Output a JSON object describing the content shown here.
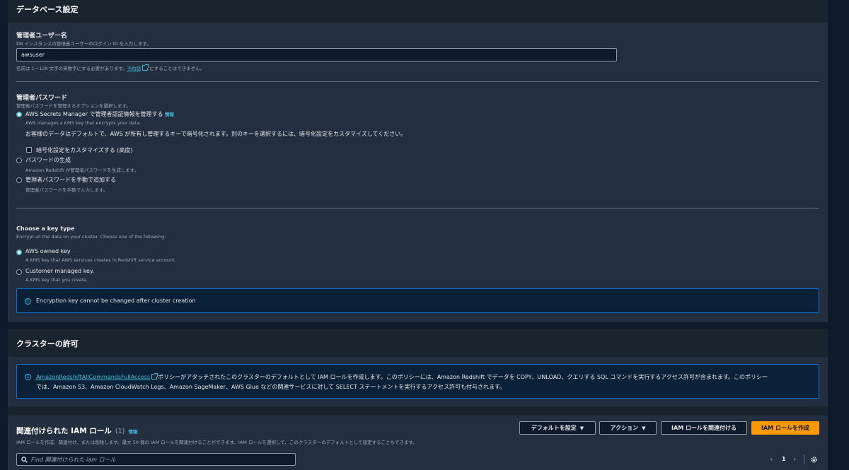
{
  "db_settings": {
    "title": "データベース設定",
    "admin_user": {
      "label": "管理者ユーザー名",
      "desc": "DB インスタンスの管理者ユーザーのログイン ID を入力します。",
      "value": "awsuser",
      "hint_before": "名前は 1〜128 文字の英数字にする必要があります。",
      "hint_link": "予約語",
      "hint_after": "にすることはできません。"
    },
    "admin_password": {
      "label": "管理者パスワード",
      "desc": "管理者パスワードを管理するオプションを選択します。",
      "options": [
        {
          "label": "AWS Secrets Manager で管理者認証情報を管理する",
          "info": "情報",
          "desc": "AWS manages a KMS key that encrypts your data.",
          "selected": true
        },
        {
          "label": "パスワードの生成",
          "desc": "Amazon Redshift が管理者パスワードを生成します。",
          "selected": false
        },
        {
          "label": "管理者パスワードを手動で追加する",
          "desc": "管理者パスワードを手動で入力します。",
          "selected": false
        }
      ],
      "encrypt_note": "お客様のデータはデフォルトで、AWS が所有し管理するキーで暗号化されます。別のキーを選択するには、暗号化設定をカスタマイズしてください。",
      "customize_checkbox": "暗号化設定をカスタマイズする (高度)"
    },
    "key_type": {
      "label": "Choose a key type",
      "desc": "Encrypt all the data on your cluster. Choose one of the following:",
      "options": [
        {
          "label": "AWS owned key",
          "desc": "A KMS key that AWS services creates in Redshift service account.",
          "selected": true
        },
        {
          "label": "Customer managed key.",
          "desc": "A KMS key that you create.",
          "selected": false
        }
      ],
      "alert": "Encryption key cannot be changed after cluster creation"
    }
  },
  "cluster_permissions": {
    "title": "クラスターの許可",
    "alert_link": "AmazonRedshiftAllCommandsFullAccess",
    "alert_line1": "ポリシーがアタッチされたこのクラスターのデフォルトとして IAM ロールを作成します。このポリシーには、Amazon Redshift でデータを COPY、UNLOAD、クエリする SQL コマンドを実行するアクセス許可が含まれます。このポリシー",
    "alert_line2": "では、Amazon S3、Amazon CloudWatch Logs、Amazon SageMaker、AWS Glue などの関連サービスに対して SELECT ステートメントを実行するアクセス許可も付与されます。"
  },
  "iam_roles": {
    "title": "関連付けられた IAM ロール",
    "count": "(1)",
    "info": "情報",
    "desc": "IAM ロールを作成、関連付け、または削除します。最大 50 個の IAM ロールを関連付けることができます。IAM ロールを選択して、このクラスターのデフォルトとして設定することもできます。",
    "buttons": {
      "set_default": "デフォルトを設定",
      "actions": "アクション",
      "associate": "IAM ロールを関連付ける",
      "create": "IAM ロールを作成"
    },
    "search_placeholder": "Find 関連付けられた iam ロール",
    "page": "1"
  }
}
